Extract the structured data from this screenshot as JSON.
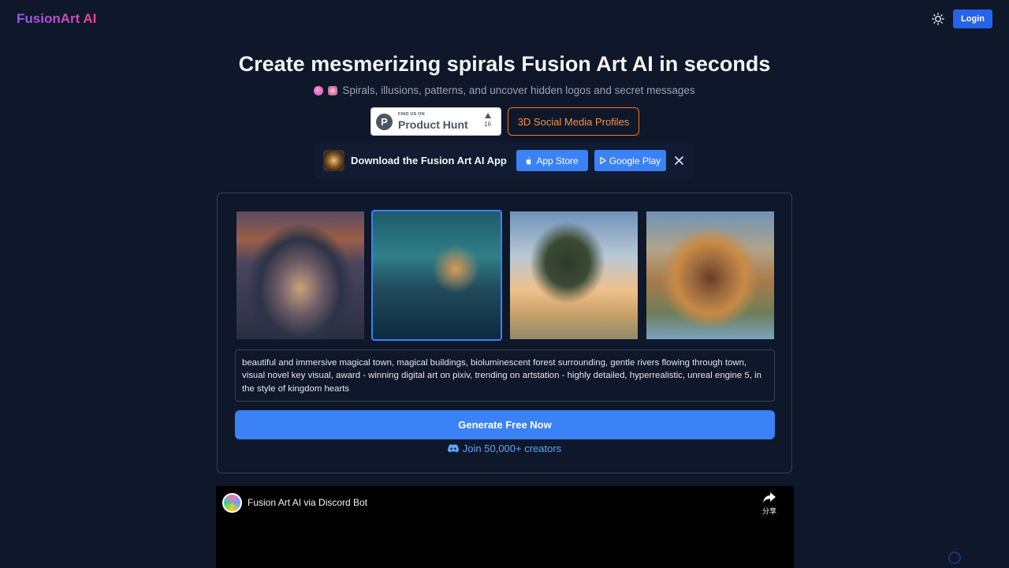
{
  "header": {
    "logo": "FusionArt AI",
    "theme_icon": "sun-icon",
    "login_label": "Login"
  },
  "hero": {
    "title": "Create mesmerizing spirals Fusion Art AI in seconds",
    "subtitle": "Spirals, illusions, patterns, and uncover hidden logos and secret messages"
  },
  "product_hunt": {
    "small_text": "FIND US ON",
    "big_text": "Product Hunt",
    "votes": "16"
  },
  "profiles_button": "3D Social Media Profiles",
  "app_banner": {
    "title": "Download the Fusion Art AI App",
    "app_store_label": "App Store",
    "google_play_label": "Google Play",
    "close_icon": "close-icon"
  },
  "gallery": {
    "selected_index": 1,
    "count": 4
  },
  "prompt": {
    "value": "beautiful and immersive magical town, magical buildings, bioluminescent forest surrounding, gentle rivers flowing through town, visual novel key visual, award - winning digital art on pixiv, trending on artstation - highly detailed, hyperrealistic, unreal engine 5, in the style of kingdom hearts"
  },
  "generate_label": "Generate Free Now",
  "discord_label": "Join 50,000+ creators",
  "video": {
    "title": "Fusion Art AI via Discord Bot",
    "share_label": "分享"
  },
  "colors": {
    "background": "#0f172a",
    "accent": "#3b82f6",
    "orange": "#f97316"
  }
}
